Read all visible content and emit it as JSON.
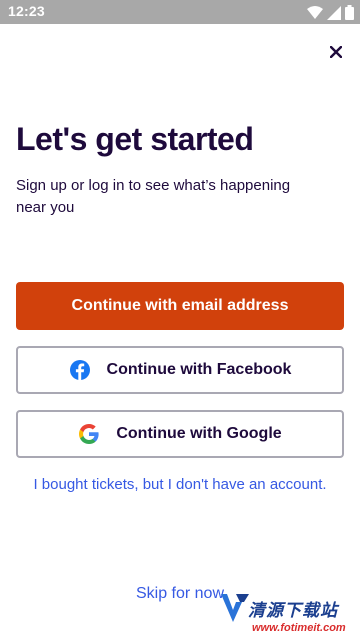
{
  "status_bar": {
    "time": "12:23"
  },
  "header": {
    "close_label": "×"
  },
  "main": {
    "title": "Let's get started",
    "subtitle": "Sign up or log in to see what’s happening near you"
  },
  "buttons": {
    "email": "Continue with email address",
    "facebook": "Continue with Facebook",
    "google": "Continue with Google"
  },
  "links": {
    "tickets": "I bought tickets, but I don't have an account.",
    "skip": "Skip for now"
  },
  "watermark": {
    "cn_text": "清源下载站",
    "url": "www.fotimeit.com"
  },
  "colors": {
    "primary": "#d1410c",
    "title": "#1e0a3c",
    "link": "#3659e3",
    "facebook": "#1877f2"
  }
}
